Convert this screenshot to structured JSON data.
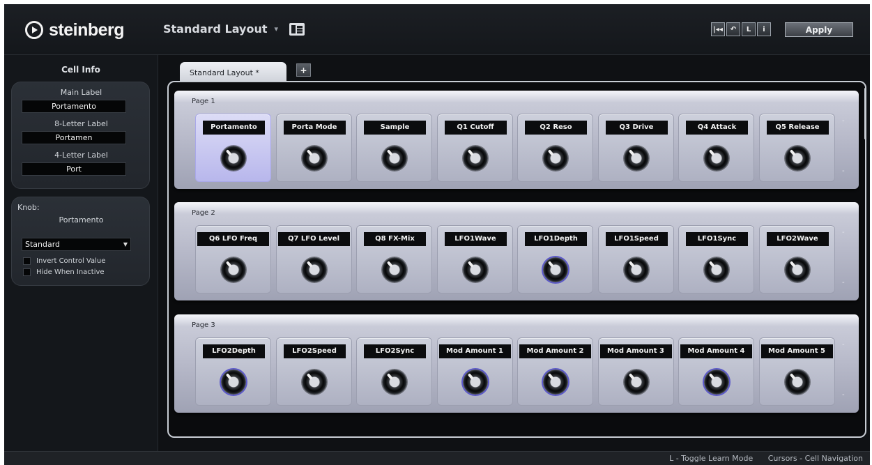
{
  "header": {
    "logo_text": "steinberg",
    "layout_title": "Standard Layout",
    "apply_label": "Apply",
    "toolbar": [
      "|◂◂",
      "↶",
      "L",
      "i"
    ]
  },
  "sidebar": {
    "title": "Cell Info",
    "main_label_caption": "Main Label",
    "main_label_value": "Portamento",
    "eight_label_caption": "8-Letter Label",
    "eight_label_value": "Portamen",
    "four_label_caption": "4-Letter Label",
    "four_label_value": "Port",
    "knob_caption": "Knob:",
    "knob_name": "Portamento",
    "mode_value": "Standard",
    "invert_label": "Invert Control Value",
    "hide_label": "Hide When Inactive"
  },
  "tabs": {
    "active_label": "Standard Layout *",
    "add_label": "+"
  },
  "pages": [
    {
      "title": "Page 1",
      "cells": [
        "Portamento",
        "Porta Mode",
        "Sample",
        "Q1 Cutoff",
        "Q2 Reso",
        "Q3 Drive",
        "Q4 Attack",
        "Q5 Release"
      ]
    },
    {
      "title": "Page 2",
      "cells": [
        "Q6 LFO Freq",
        "Q7 LFO Level",
        "Q8 FX-Mix",
        "LFO1Wave",
        "LFO1Depth",
        "LFO1Speed",
        "LFO1Sync",
        "LFO2Wave"
      ]
    },
    {
      "title": "Page 3",
      "cells": [
        "LFO2Depth",
        "LFO2Speed",
        "LFO2Sync",
        "Mod Amount 1",
        "Mod Amount 2",
        "Mod Amount 3",
        "Mod Amount 4",
        "Mod Amount 5"
      ]
    }
  ],
  "status": {
    "learn_hint": "L - Toggle Learn Mode",
    "nav_hint": "Cursors - Cell Navigation"
  }
}
